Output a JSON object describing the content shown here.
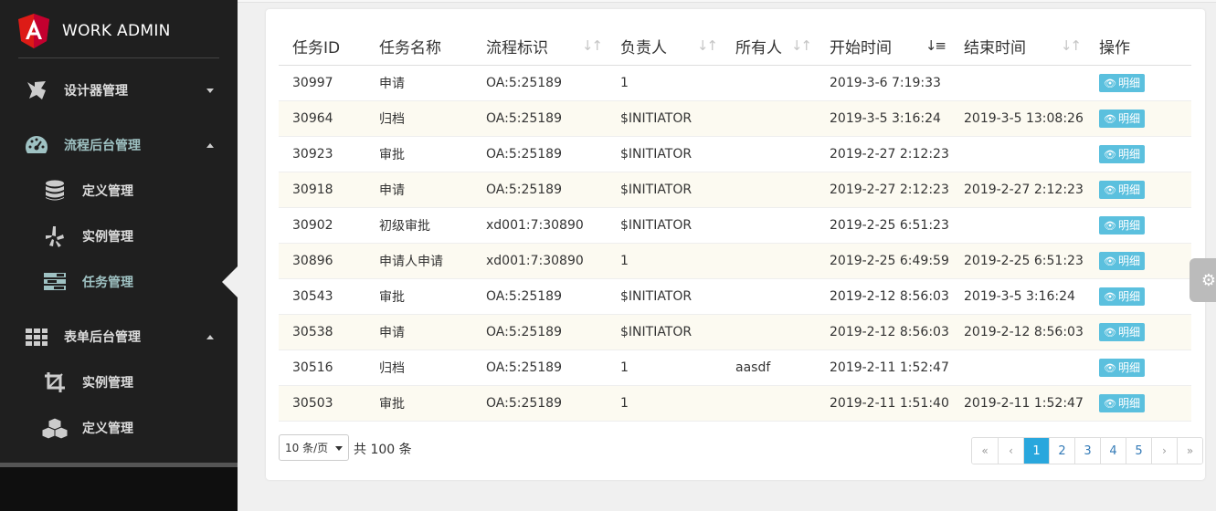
{
  "app": {
    "title": "WORK ADMIN"
  },
  "sidebar": {
    "items": [
      {
        "label": "设计器管理",
        "icon": "designer-icon",
        "state": "collapsed"
      },
      {
        "label": "流程后台管理",
        "icon": "dashboard-icon",
        "state": "expanded"
      },
      {
        "label": "定义管理",
        "icon": "database-icon",
        "state": "child"
      },
      {
        "label": "实例管理",
        "icon": "yelp-icon",
        "state": "child"
      },
      {
        "label": "任务管理",
        "icon": "tasks-icon",
        "state": "child-active"
      },
      {
        "label": "表单后台管理",
        "icon": "grid-icon",
        "state": "expanded"
      },
      {
        "label": "实例管理",
        "icon": "crop-icon",
        "state": "child"
      },
      {
        "label": "定义管理",
        "icon": "cubes-icon",
        "state": "child"
      }
    ]
  },
  "table": {
    "columns": [
      "任务ID",
      "任务名称",
      "流程标识",
      "负责人",
      "所有人",
      "开始时间",
      "结束时间",
      "操作"
    ],
    "detail_label": "明细",
    "rows": [
      [
        "30997",
        "申请",
        "OA:5:25189",
        "1",
        "",
        "2019-3-6 7:19:33",
        ""
      ],
      [
        "30964",
        "归档",
        "OA:5:25189",
        "$INITIATOR",
        "",
        "2019-3-5 3:16:24",
        "2019-3-5 13:08:26"
      ],
      [
        "30923",
        "审批",
        "OA:5:25189",
        "$INITIATOR",
        "",
        "2019-2-27 2:12:23",
        ""
      ],
      [
        "30918",
        "申请",
        "OA:5:25189",
        "$INITIATOR",
        "",
        "2019-2-27 2:12:23",
        "2019-2-27 2:12:23"
      ],
      [
        "30902",
        "初级审批",
        "xd001:7:30890",
        "$INITIATOR",
        "",
        "2019-2-25 6:51:23",
        ""
      ],
      [
        "30896",
        "申请人申请",
        "xd001:7:30890",
        "1",
        "",
        "2019-2-25 6:49:59",
        "2019-2-25 6:51:23"
      ],
      [
        "30543",
        "审批",
        "OA:5:25189",
        "$INITIATOR",
        "",
        "2019-2-12 8:56:03",
        "2019-3-5 3:16:24"
      ],
      [
        "30538",
        "申请",
        "OA:5:25189",
        "$INITIATOR",
        "",
        "2019-2-12 8:56:03",
        "2019-2-12 8:56:03"
      ],
      [
        "30516",
        "归档",
        "OA:5:25189",
        "1",
        "aasdf",
        "2019-2-11 1:52:47",
        ""
      ],
      [
        "30503",
        "审批",
        "OA:5:25189",
        "1",
        "",
        "2019-2-11 1:51:40",
        "2019-2-11 1:52:47"
      ]
    ]
  },
  "footer": {
    "page_size": "10 条/页",
    "total": "共 100 条",
    "pages": [
      "«",
      "‹",
      "1",
      "2",
      "3",
      "4",
      "5",
      "›",
      "»"
    ],
    "current_page": "1"
  },
  "colors": {
    "sidebar_bg": "#1f1f1f",
    "accent": "#29a7dd",
    "detail_button": "#5bc0de",
    "angular_red": "#dd1b16"
  }
}
